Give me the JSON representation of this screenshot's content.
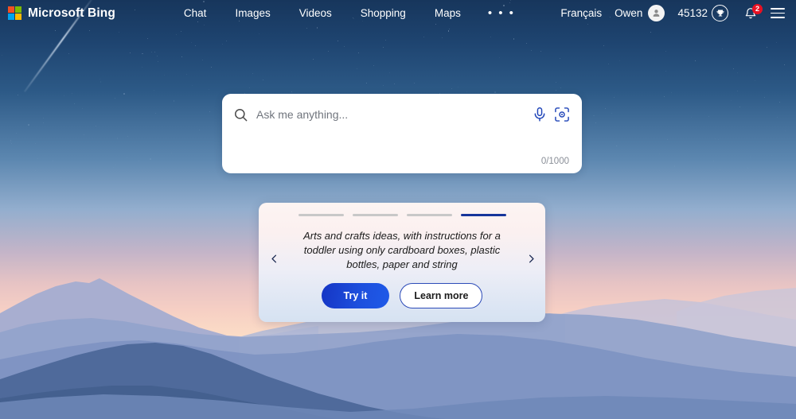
{
  "header": {
    "brand": "Microsoft Bing",
    "logo_icon": "microsoft-logo-icon",
    "logo_colors": [
      "#f25022",
      "#7fba00",
      "#00a4ef",
      "#ffb900"
    ],
    "nav": [
      {
        "label": "Chat",
        "name": "nav-chat"
      },
      {
        "label": "Images",
        "name": "nav-images"
      },
      {
        "label": "Videos",
        "name": "nav-videos"
      },
      {
        "label": "Shopping",
        "name": "nav-shopping"
      },
      {
        "label": "Maps",
        "name": "nav-maps"
      },
      {
        "label": "• • •",
        "name": "nav-more"
      }
    ],
    "language": "Français",
    "account_name": "Owen",
    "avatar_icon": "person-icon",
    "rewards_points": "45132",
    "rewards_icon": "trophy-icon",
    "notifications_icon": "bell-icon",
    "notifications_count": "2",
    "notifications_badge_color": "#e81123",
    "menu_icon": "hamburger-icon"
  },
  "search": {
    "search_icon": "search-icon",
    "placeholder": "Ask me anything...",
    "value": "",
    "mic_icon": "microphone-icon",
    "visual_search_icon": "visual-search-icon",
    "char_counter": "0/1000",
    "accent_color": "#1f44b8"
  },
  "carousel": {
    "prev_icon": "chevron-left-icon",
    "next_icon": "chevron-right-icon",
    "slide_count": 4,
    "active_slide": 4,
    "text": "Arts and crafts ideas, with instructions for a toddler using only cardboard boxes, plastic bottles, paper and string",
    "primary_button": "Try it",
    "secondary_button": "Learn more",
    "active_bar_color": "#16359b",
    "inactive_bar_color": "#c8c8c8"
  },
  "background": {
    "description": "sunset-mountain-landscape",
    "sky_top_color": "#17365c",
    "sky_bottom_color": "#fdf6e6",
    "meteor": "shooting-star-streak"
  }
}
